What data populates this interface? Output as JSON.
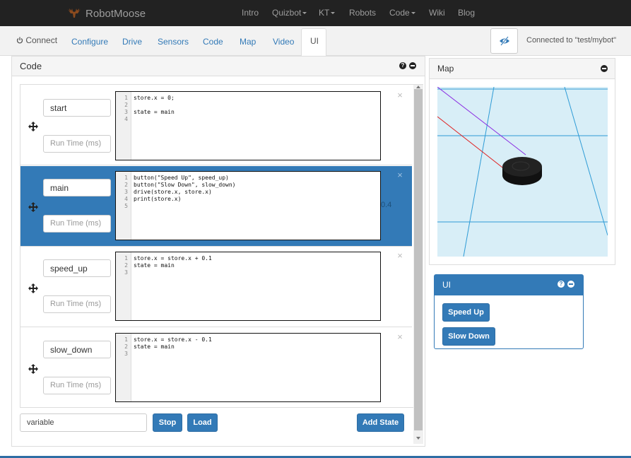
{
  "navbar": {
    "brand": "RobotMoose",
    "links": [
      "Intro",
      "Quizbot",
      "KT",
      "Robots",
      "Code",
      "Wiki",
      "Blog"
    ]
  },
  "tabs": {
    "connect": "Connect",
    "configure": "Configure",
    "drive": "Drive",
    "sensors": "Sensors",
    "code": "Code",
    "map": "Map",
    "video": "Video",
    "ui": "UI"
  },
  "connection_status": "Connected to \"test/mybot\"",
  "code_panel": {
    "title": "Code",
    "runtime_placeholder": "Run Time (ms)",
    "states": [
      {
        "name": "start",
        "lines": [
          "1",
          "2",
          "3",
          "4"
        ],
        "code": "store.x = 0;\n\nstate = main\n",
        "value": ""
      },
      {
        "name": "main",
        "lines": [
          "1",
          "2",
          "3",
          "4",
          "5"
        ],
        "code": "button(\"Speed Up\", speed_up)\nbutton(\"Slow Down\", slow_down)\ndrive(store.x, store.x)\nprint(store.x)\n",
        "value": "0.4"
      },
      {
        "name": "speed_up",
        "lines": [
          "1",
          "2",
          "3"
        ],
        "code": "store.x = store.x + 0.1\nstate = main\n",
        "value": ""
      },
      {
        "name": "slow_down",
        "lines": [
          "1",
          "2",
          "3"
        ],
        "code": "store.x = store.x - 0.1\nstate = main\n",
        "value": ""
      }
    ],
    "variable_input": "variable",
    "stop_label": "Stop",
    "load_label": "Load",
    "add_state_label": "Add State"
  },
  "map_panel": {
    "title": "Map"
  },
  "ui_panel": {
    "title": "UI",
    "buttons": [
      "Speed Up",
      "Slow Down"
    ]
  },
  "icons": {
    "help": "question-circle-icon",
    "collapse": "minus-circle-icon",
    "move": "move-arrows-icon",
    "close": "close-icon",
    "power": "power-icon",
    "eye": "eye-slash-icon"
  },
  "colors": {
    "navbar": "#222222",
    "primary": "#337ab7",
    "map_floor": "#d8eef7",
    "map_grid": "#2e9bd6"
  }
}
